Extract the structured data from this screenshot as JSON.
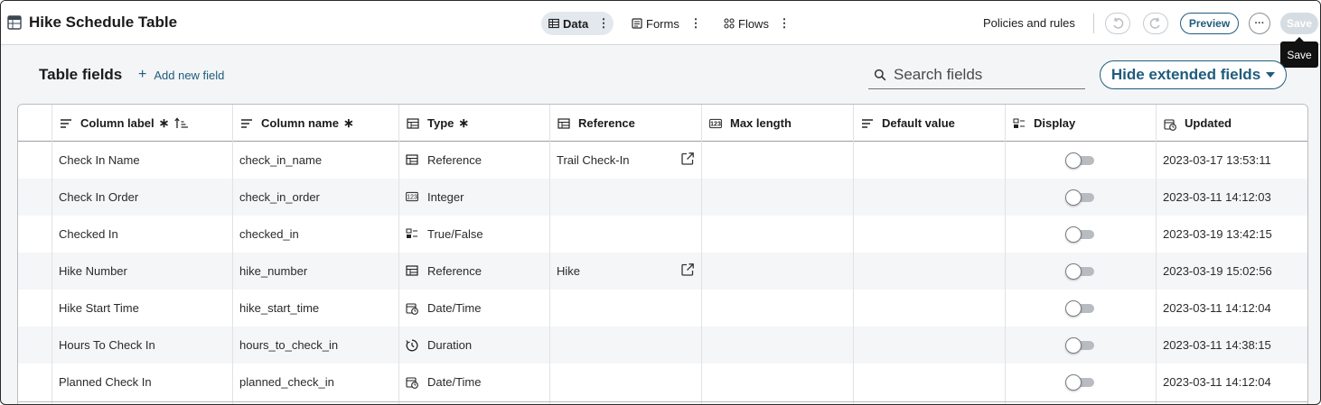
{
  "header": {
    "title": "Hike Schedule Table",
    "tabs": [
      {
        "label": "Data",
        "icon": "table-icon",
        "active": true
      },
      {
        "label": "Forms",
        "icon": "form-icon",
        "active": false
      },
      {
        "label": "Flows",
        "icon": "flow-icon",
        "active": false
      }
    ],
    "policies_label": "Policies and rules",
    "preview_label": "Preview",
    "more_label": "···",
    "save_label": "Save",
    "tooltip": "Save"
  },
  "section": {
    "title": "Table fields",
    "add_field_label": "Add new field",
    "search_placeholder": "Search fields",
    "hide_extended_label": "Hide extended fields"
  },
  "columns": [
    {
      "label": "Column label",
      "required": "∗",
      "icon": "text-lines-icon"
    },
    {
      "label": "Column name",
      "required": "∗",
      "icon": "text-lines-icon"
    },
    {
      "label": "Type",
      "required": "∗",
      "icon": "grid-icon"
    },
    {
      "label": "Reference",
      "required": "",
      "icon": "grid-icon"
    },
    {
      "label": "Max length",
      "required": "",
      "icon": "number-icon"
    },
    {
      "label": "Default value",
      "required": "",
      "icon": "text-lines-icon"
    },
    {
      "label": "Display",
      "required": "",
      "icon": "toggle-box-icon"
    },
    {
      "label": "Updated",
      "required": "",
      "icon": "calendar-clock-icon"
    }
  ],
  "rows": [
    {
      "label": "Check In Name",
      "name": "check_in_name",
      "type": "Reference",
      "type_icon": "reference",
      "reference": "Trail Check-In",
      "has_link": true,
      "display": false,
      "updated": "2023-03-17 13:53:11"
    },
    {
      "label": "Check In Order",
      "name": "check_in_order",
      "type": "Integer",
      "type_icon": "integer",
      "reference": "",
      "has_link": false,
      "display": false,
      "updated": "2023-03-11 14:12:03"
    },
    {
      "label": "Checked In",
      "name": "checked_in",
      "type": "True/False",
      "type_icon": "boolean",
      "reference": "",
      "has_link": false,
      "display": false,
      "updated": "2023-03-19 13:42:15"
    },
    {
      "label": "Hike Number",
      "name": "hike_number",
      "type": "Reference",
      "type_icon": "reference",
      "reference": "Hike",
      "has_link": true,
      "display": false,
      "updated": "2023-03-19 15:02:56"
    },
    {
      "label": "Hike Start Time",
      "name": "hike_start_time",
      "type": "Date/Time",
      "type_icon": "datetime",
      "reference": "",
      "has_link": false,
      "display": false,
      "updated": "2023-03-11 14:12:04"
    },
    {
      "label": "Hours To Check In",
      "name": "hours_to_check_in",
      "type": "Duration",
      "type_icon": "duration",
      "reference": "",
      "has_link": false,
      "display": false,
      "updated": "2023-03-11 14:38:15"
    },
    {
      "label": "Planned Check In",
      "name": "planned_check_in",
      "type": "Date/Time",
      "type_icon": "datetime",
      "reference": "",
      "has_link": false,
      "display": false,
      "updated": "2023-03-11 14:12:04"
    }
  ],
  "colors": {
    "accent": "#1f5c7d",
    "active_tab_bg": "#e3e8ee",
    "save_disabled": "#d5dde3"
  }
}
